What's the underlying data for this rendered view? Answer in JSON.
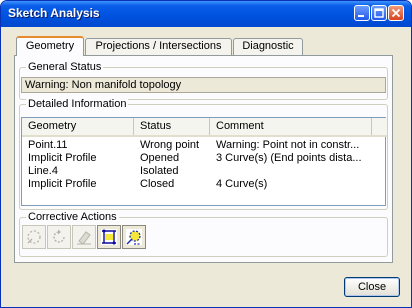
{
  "window": {
    "title": "Sketch Analysis"
  },
  "tabs": [
    {
      "label": "Geometry",
      "active": true
    },
    {
      "label": "Projections / Intersections",
      "active": false
    },
    {
      "label": "Diagnostic",
      "active": false
    }
  ],
  "general_status": {
    "legend": "General Status",
    "message": "Warning: Non manifold topology"
  },
  "detailed_info": {
    "legend": "Detailed Information",
    "columns": [
      "Geometry",
      "Status",
      "Comment"
    ],
    "rows": [
      {
        "geometry": "Point.11",
        "status": "Wrong point",
        "comment": "Warning: Point not in constr..."
      },
      {
        "geometry": "Implicit Profile",
        "status": "Opened",
        "comment": "3 Curve(s) (End points dista..."
      },
      {
        "geometry": "Line.4",
        "status": "Isolated",
        "comment": ""
      },
      {
        "geometry": "Implicit Profile",
        "status": "Closed",
        "comment": "4 Curve(s)"
      }
    ]
  },
  "corrective_actions": {
    "legend": "Corrective Actions",
    "tools": [
      {
        "icon": "construction-toggle-icon",
        "enabled": false
      },
      {
        "icon": "rotate-icon",
        "enabled": false
      },
      {
        "icon": "eraser-icon",
        "enabled": false
      },
      {
        "icon": "show-geometry-icon",
        "enabled": true
      },
      {
        "icon": "hide-geometry-icon",
        "enabled": true
      }
    ]
  },
  "buttons": {
    "close": "Close"
  },
  "colors": {
    "titlebar": "#0053e0",
    "tab_highlight": "#e68b2c",
    "dialog_bg": "#ece9d8"
  }
}
